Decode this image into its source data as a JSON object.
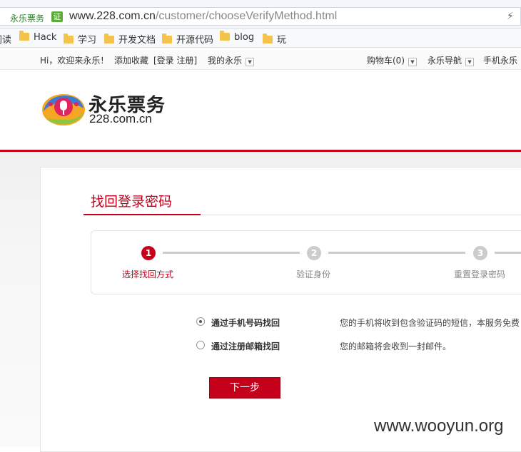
{
  "browser": {
    "site_name": "永乐票务",
    "cert_badge": "证",
    "url_host": "www.228.com.cn",
    "url_path": "/customer/chooseVerifyMethod.html",
    "bookmarks": [
      {
        "label": "阅读",
        "folder": false
      },
      {
        "label": "Hack",
        "folder": true
      },
      {
        "label": "学习",
        "folder": true
      },
      {
        "label": "开发文档",
        "folder": true
      },
      {
        "label": "开源代码",
        "folder": true
      },
      {
        "label": "blog",
        "folder": true
      },
      {
        "label": "玩",
        "folder": true
      }
    ]
  },
  "topbar": {
    "greeting": "Hi，欢迎来永乐！",
    "favorite": "添加收藏",
    "login_register": "[登录 注册]",
    "my_yongle": "我的永乐",
    "cart": "购物车(0)",
    "nav": "永乐导航",
    "mobile": "手机永乐"
  },
  "header": {
    "logo_cn": "永乐票务",
    "logo_en": "228.com.cn"
  },
  "page": {
    "title": "找回登录密码",
    "steps": [
      {
        "number": "1",
        "label": "选择找回方式",
        "active": true
      },
      {
        "number": "2",
        "label": "验证身份",
        "active": false
      },
      {
        "number": "3",
        "label": "重置登录密码",
        "active": false
      }
    ],
    "options": [
      {
        "label": "通过手机号码找回",
        "desc": "您的手机将收到包含验证码的短信，本服务免费",
        "selected": true
      },
      {
        "label": "通过注册邮箱找回",
        "desc": "您的邮箱将会收到一封邮件。",
        "selected": false
      }
    ],
    "next_button": "下一步"
  },
  "watermark": "www.wooyun.org",
  "colors": {
    "brand_red": "#c4001a",
    "inactive_step": "#cccccc"
  }
}
